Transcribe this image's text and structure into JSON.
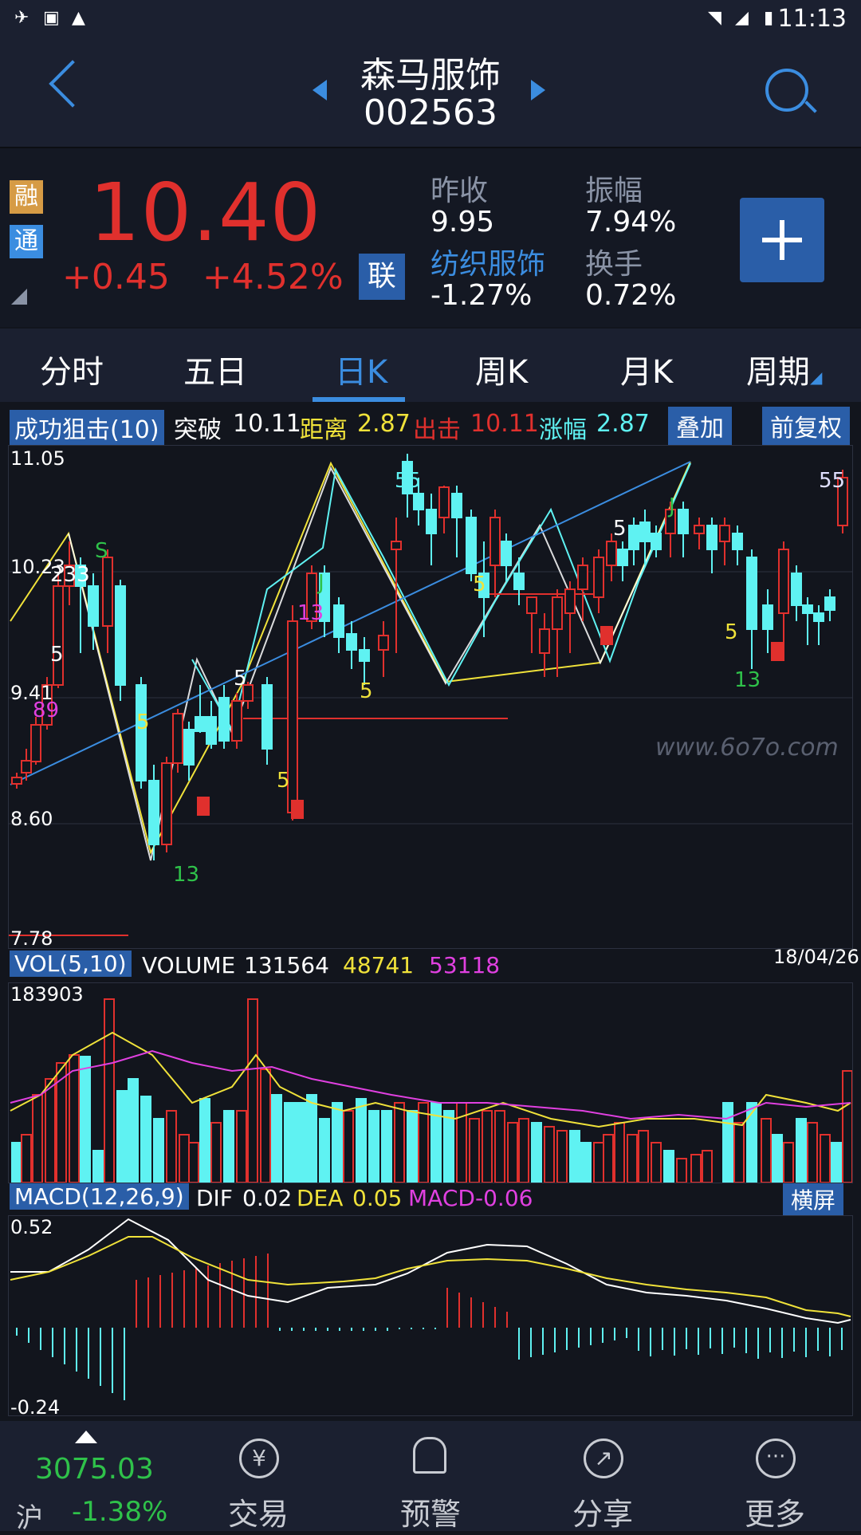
{
  "status_bar": {
    "time": "11:13"
  },
  "header": {
    "stock_name": "森马服饰",
    "stock_code": "002563"
  },
  "quote": {
    "badge_rong": "融",
    "badge_tong": "通",
    "price": "10.40",
    "change": "+0.45",
    "change_pct": "+4.52%",
    "lian": "联",
    "prev_close_label": "昨收",
    "prev_close": "9.95",
    "amplitude_label": "振幅",
    "amplitude": "7.94%",
    "sector_label": "纺织服饰",
    "sector_change": "-1.27%",
    "turnover_label": "换手",
    "turnover": "0.72%"
  },
  "tabs": [
    {
      "label": "分时"
    },
    {
      "label": "五日"
    },
    {
      "label": "日K",
      "active": true
    },
    {
      "label": "周K"
    },
    {
      "label": "月K"
    },
    {
      "label": "周期"
    }
  ],
  "indicator_bar": {
    "name": "成功狙击(10)",
    "break_label": "突破",
    "break_value": "10.11",
    "dist_label": "距离",
    "dist_value": "2.87",
    "hit_label": "出击",
    "hit_value": "10.11",
    "rise_label": "涨幅",
    "rise_value": "2.87",
    "overlay_label": "叠加",
    "adjust_label": "前复权"
  },
  "kline_axis": {
    "top": "11.05",
    "y2": "10.23",
    "y3": "9.41",
    "y4": "8.60",
    "bottom": "7.78"
  },
  "watermark": "www.6o7o.com",
  "volume": {
    "label": "VOL(5,10)",
    "volume_label": "VOLUME",
    "volume_value": "131564",
    "ma5": "48741",
    "ma10": "53118",
    "max": "183903",
    "date": "18/04/26"
  },
  "macd": {
    "label": "MACD(12,26,9)",
    "dif_label": "DIF",
    "dif": "0.02",
    "dea_label": "DEA",
    "dea": "0.05",
    "macd_label": "MACD",
    "macd": "-0.06",
    "landscape": "横屏",
    "top": "0.52",
    "bottom": "-0.24"
  },
  "bottom_nav": {
    "index_value": "3075.03",
    "index_name": "沪",
    "index_change": "-1.38%",
    "items": [
      {
        "label": "交易",
        "icon": "trade-icon"
      },
      {
        "label": "预警",
        "icon": "bell-icon"
      },
      {
        "label": "分享",
        "icon": "share-icon"
      },
      {
        "label": "更多",
        "icon": "more-icon"
      }
    ]
  },
  "colors": {
    "up": "#e0302d",
    "down": "#5ff2f2",
    "accent": "#3b8de0",
    "yellow": "#f0e23a",
    "magenta": "#e040e0"
  }
}
